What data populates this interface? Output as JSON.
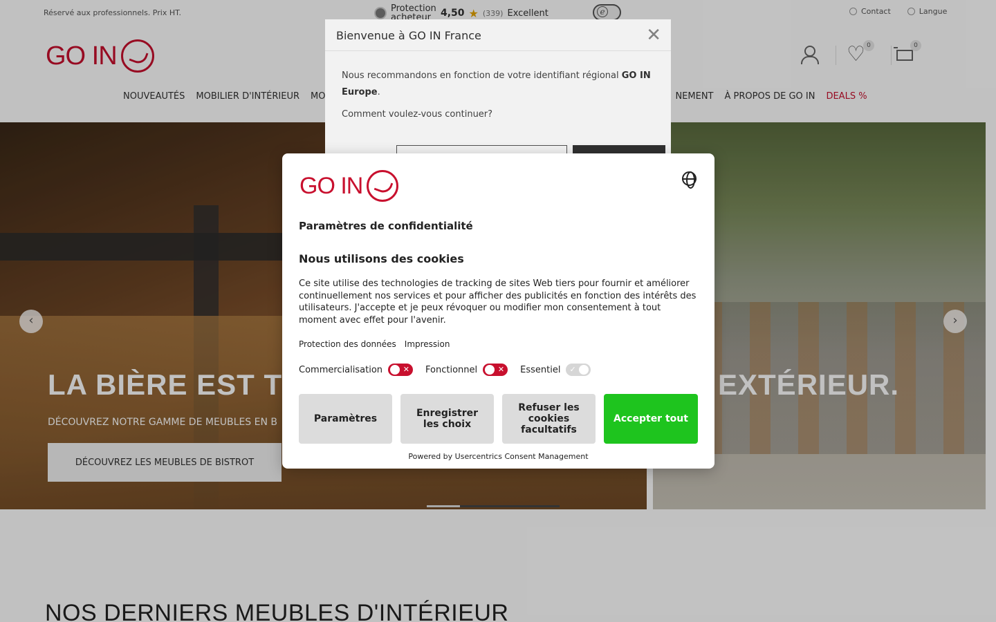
{
  "topbar": {
    "notice": "Réservé aux professionnels. Prix HT.",
    "trust_protection": "Protection acheteur",
    "trust_rating": "4,50",
    "trust_count": "(339)",
    "trust_label": "Excellent",
    "contact": "Contact",
    "language": "Langue"
  },
  "header": {
    "logo_text": "GO IN",
    "wishlist_count": "0",
    "cart_count": "0"
  },
  "nav": {
    "items": [
      "NOUVEAUTÉS",
      "MOBILIER D'INTÉRIEUR",
      "MO",
      "NEMENT",
      "À PROPOS DE GO IN",
      "DEALS %"
    ]
  },
  "hero": {
    "title_left": "LA BIÈRE EST TIR",
    "title_right": "EXTÉRIEUR.",
    "subtitle": "DÉCOUVREZ NOTRE GAMME DE MEUBLES EN B",
    "button": "DÉCOUVREZ LES MEUBLES DE BISTROT",
    "prev": "‹",
    "next": "›"
  },
  "section": {
    "title": "NOS DERNIERS MEUBLES D'INTÉRIEUR"
  },
  "region_modal": {
    "title": "Bienvenue à GO IN France",
    "close": "✕",
    "text_before": "Nous recommandons en fonction de votre identifiant régional ",
    "text_bold": "GO IN Europe",
    "text_after": ".",
    "question": "Comment voulez-vous continuer?"
  },
  "cookie": {
    "logo_text": "GO IN",
    "heading": "Paramètres de confidentialité",
    "subheading": "Nous utilisons des cookies",
    "description": "Ce site utilise des technologies de tracking de sites Web tiers pour fournir et améliorer continuellement nos services et pour afficher des publicités en fonction des intérêts des utilisateurs. J'accepte et je peux révoquer ou modifier mon consentement à tout moment avec effet pour l'avenir.",
    "link_privacy": "Protection des données",
    "link_imprint": "Impression",
    "toggle_marketing": "Commercialisation",
    "toggle_functional": "Fonctionnel",
    "toggle_essential": "Essentiel",
    "btn_settings": "Paramètres",
    "btn_save": "Enregistrer les choix",
    "btn_refuse": "Refuser les cookies facultatifs",
    "btn_accept": "Accepter tout",
    "powered": "Powered by Usercentrics Consent Management"
  },
  "colors": {
    "brand": "#c8102e",
    "accept": "#1ec41e"
  }
}
